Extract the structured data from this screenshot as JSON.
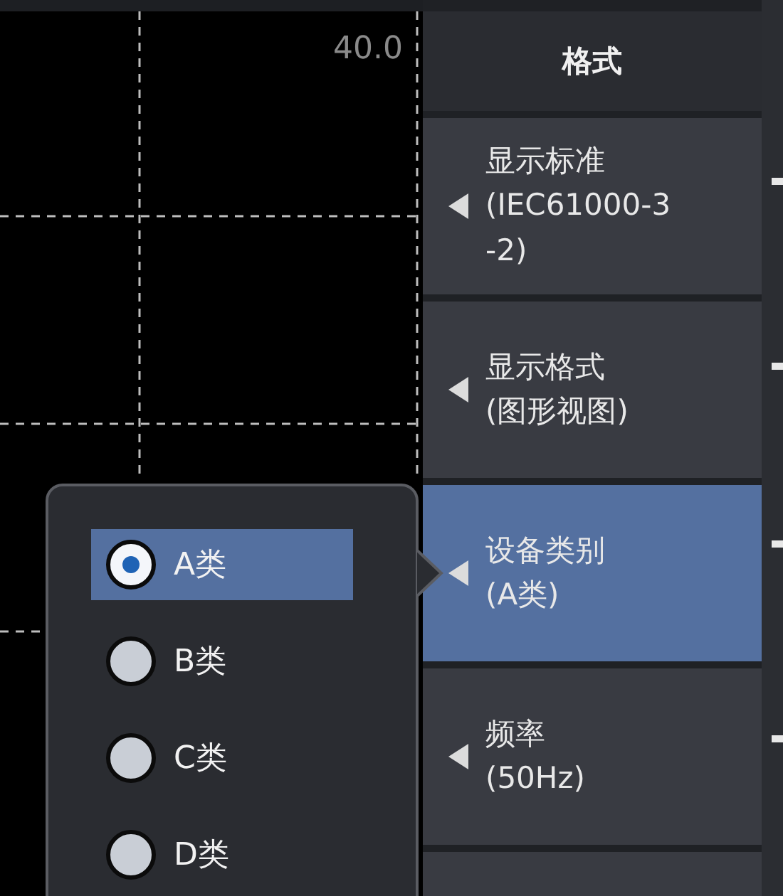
{
  "plot": {
    "axis_label": "40.0"
  },
  "menu": {
    "title": "格式",
    "items": [
      {
        "lines": [
          "显示标准",
          "(IEC61000-3",
          "-2)"
        ],
        "selected": false
      },
      {
        "lines": [
          "显示格式",
          "(图形视图)"
        ],
        "selected": false
      },
      {
        "lines": [
          "设备类别",
          "(A类)"
        ],
        "selected": true
      },
      {
        "lines": [
          "频率",
          "(50Hz)"
        ],
        "selected": false
      }
    ]
  },
  "popup": {
    "options": [
      {
        "label": "A类",
        "selected": true
      },
      {
        "label": "B类",
        "selected": false
      },
      {
        "label": "C类",
        "selected": false
      },
      {
        "label": "D类",
        "selected": false
      }
    ]
  }
}
